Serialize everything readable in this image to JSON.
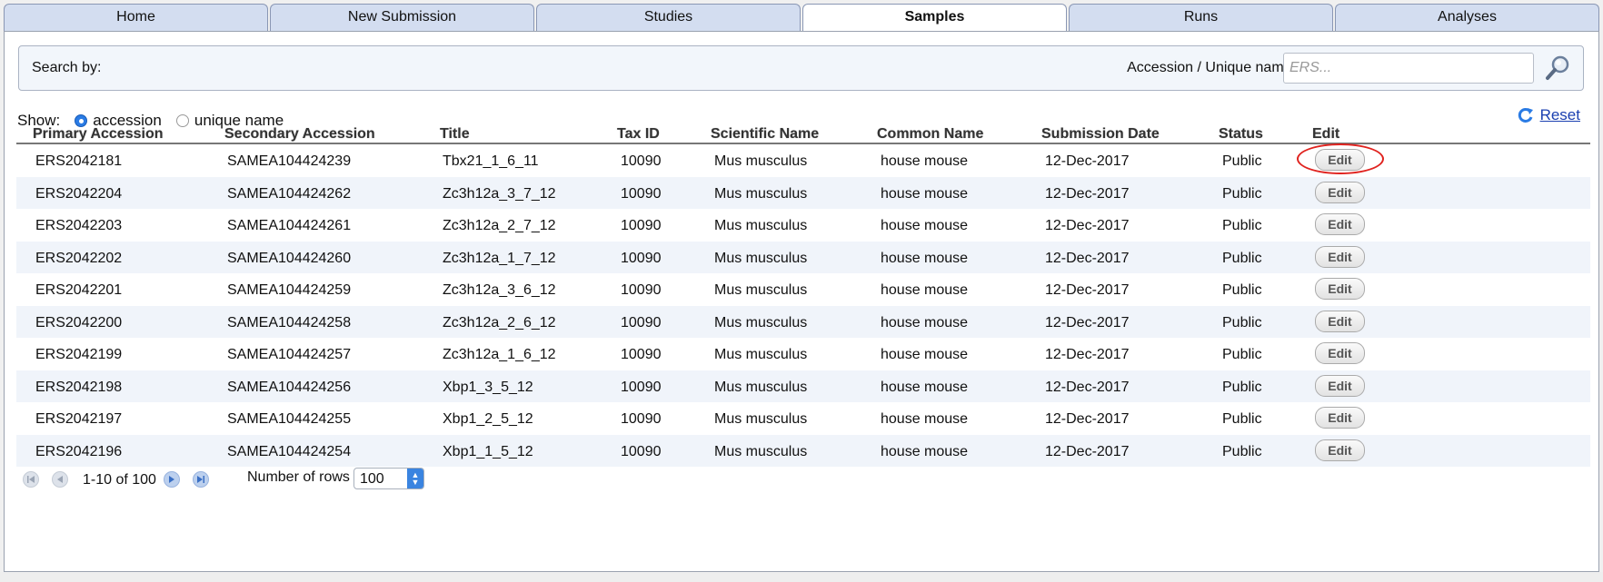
{
  "tabs": [
    {
      "label": "Home",
      "active": false
    },
    {
      "label": "New Submission",
      "active": false
    },
    {
      "label": "Studies",
      "active": false
    },
    {
      "label": "Samples",
      "active": true
    },
    {
      "label": "Runs",
      "active": false
    },
    {
      "label": "Analyses",
      "active": false
    }
  ],
  "search": {
    "label": "Search by:",
    "field_label": "Accession / Unique name:",
    "placeholder": "ERS...",
    "value": "",
    "button_icon": "search-icon"
  },
  "show": {
    "label": "Show:",
    "options": [
      {
        "label": "accession",
        "selected": true
      },
      {
        "label": "unique name",
        "selected": false
      }
    ]
  },
  "reset": {
    "label": "Reset",
    "icon": "refresh-icon"
  },
  "table": {
    "columns": [
      "Primary Accession",
      "Secondary Accession",
      "Title",
      "Tax ID",
      "Scientific Name",
      "Common Name",
      "Submission Date",
      "Status",
      "Edit"
    ],
    "rows": [
      {
        "primary": "ERS2042181",
        "secondary": "SAMEA104424239",
        "title": "Tbx21_1_6_11",
        "taxid": "10090",
        "scientific": "Mus musculus",
        "common": "house mouse",
        "date": "12-Dec-2017",
        "status": "Public",
        "edit": "Edit"
      },
      {
        "primary": "ERS2042204",
        "secondary": "SAMEA104424262",
        "title": "Zc3h12a_3_7_12",
        "taxid": "10090",
        "scientific": "Mus musculus",
        "common": "house mouse",
        "date": "12-Dec-2017",
        "status": "Public",
        "edit": "Edit"
      },
      {
        "primary": "ERS2042203",
        "secondary": "SAMEA104424261",
        "title": "Zc3h12a_2_7_12",
        "taxid": "10090",
        "scientific": "Mus musculus",
        "common": "house mouse",
        "date": "12-Dec-2017",
        "status": "Public",
        "edit": "Edit"
      },
      {
        "primary": "ERS2042202",
        "secondary": "SAMEA104424260",
        "title": "Zc3h12a_1_7_12",
        "taxid": "10090",
        "scientific": "Mus musculus",
        "common": "house mouse",
        "date": "12-Dec-2017",
        "status": "Public",
        "edit": "Edit"
      },
      {
        "primary": "ERS2042201",
        "secondary": "SAMEA104424259",
        "title": "Zc3h12a_3_6_12",
        "taxid": "10090",
        "scientific": "Mus musculus",
        "common": "house mouse",
        "date": "12-Dec-2017",
        "status": "Public",
        "edit": "Edit"
      },
      {
        "primary": "ERS2042200",
        "secondary": "SAMEA104424258",
        "title": "Zc3h12a_2_6_12",
        "taxid": "10090",
        "scientific": "Mus musculus",
        "common": "house mouse",
        "date": "12-Dec-2017",
        "status": "Public",
        "edit": "Edit"
      },
      {
        "primary": "ERS2042199",
        "secondary": "SAMEA104424257",
        "title": "Zc3h12a_1_6_12",
        "taxid": "10090",
        "scientific": "Mus musculus",
        "common": "house mouse",
        "date": "12-Dec-2017",
        "status": "Public",
        "edit": "Edit"
      },
      {
        "primary": "ERS2042198",
        "secondary": "SAMEA104424256",
        "title": "Xbp1_3_5_12",
        "taxid": "10090",
        "scientific": "Mus musculus",
        "common": "house mouse",
        "date": "12-Dec-2017",
        "status": "Public",
        "edit": "Edit"
      },
      {
        "primary": "ERS2042197",
        "secondary": "SAMEA104424255",
        "title": "Xbp1_2_5_12",
        "taxid": "10090",
        "scientific": "Mus musculus",
        "common": "house mouse",
        "date": "12-Dec-2017",
        "status": "Public",
        "edit": "Edit"
      },
      {
        "primary": "ERS2042196",
        "secondary": "SAMEA104424254",
        "title": "Xbp1_1_5_12",
        "taxid": "10090",
        "scientific": "Mus musculus",
        "common": "house mouse",
        "date": "12-Dec-2017",
        "status": "Public",
        "edit": "Edit"
      }
    ]
  },
  "pager": {
    "info": "1-10 of 100",
    "rows_label": "Number of rows",
    "rows_value": "100",
    "icons": [
      "first-page-icon",
      "prev-page-icon",
      "next-page-icon",
      "last-page-icon"
    ]
  },
  "colors": {
    "highlight": "#e0231f",
    "tab_bg": "#d3ddf0",
    "link": "#1a3fb0"
  }
}
